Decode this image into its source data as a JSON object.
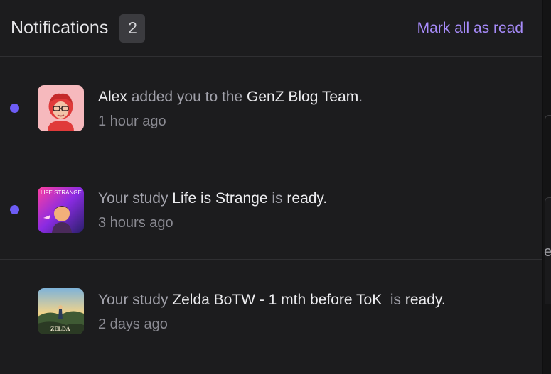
{
  "header": {
    "title": "Notifications",
    "count": "2",
    "mark_all_label": "Mark all as read"
  },
  "colors": {
    "accent": "#a78bfa",
    "unread_dot": "#6d5cf5",
    "panel_bg": "#1c1c1e"
  },
  "notifications": [
    {
      "unread": true,
      "avatar_icon": "memoji-avatar-icon",
      "parts": [
        "Alex",
        " added you to the ",
        "GenZ Blog Team",
        "."
      ],
      "time": "1 hour ago"
    },
    {
      "unread": true,
      "avatar_icon": "life-is-strange-cover-icon",
      "avatar_text": "LIFE STRANGE",
      "parts": [
        "Your study ",
        "Life is Strange",
        " is ",
        "ready."
      ],
      "time": "3 hours ago"
    },
    {
      "unread": false,
      "avatar_icon": "zelda-cover-icon",
      "avatar_text": "ZELDA",
      "parts": [
        "Your study ",
        "Zelda BoTW - 1 mth before ToK",
        "  is ",
        "ready."
      ],
      "time": "2 days ago"
    }
  ],
  "backdrop": {
    "glyph": "e"
  }
}
